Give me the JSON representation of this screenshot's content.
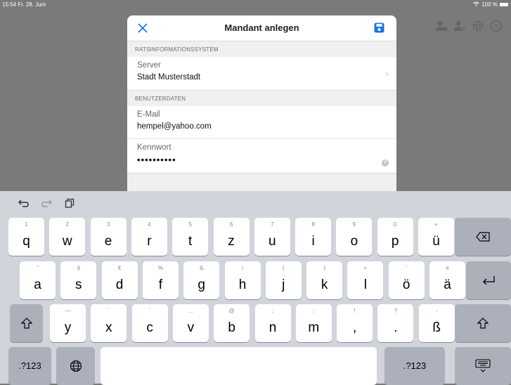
{
  "status": {
    "time": "15:54",
    "date": "Fr. 28. Juni",
    "battery": "100 %"
  },
  "modal": {
    "title": "Mandant anlegen",
    "section1": "RATSINFORMATIONSSYSTEM",
    "server_label": "Server",
    "server_value": "Stadt Musterstadt",
    "section2": "BENUTZERDATEN",
    "email_label": "E-Mail",
    "email_value": "hempel@yahoo.com",
    "password_label": "Kennwort",
    "password_value": "••••••••••"
  },
  "keyboard": {
    "row1": [
      {
        "hint": "1",
        "key": "q"
      },
      {
        "hint": "2",
        "key": "w"
      },
      {
        "hint": "3",
        "key": "e"
      },
      {
        "hint": "4",
        "key": "r"
      },
      {
        "hint": "5",
        "key": "t"
      },
      {
        "hint": "6",
        "key": "z"
      },
      {
        "hint": "7",
        "key": "u"
      },
      {
        "hint": "8",
        "key": "i"
      },
      {
        "hint": "9",
        "key": "o"
      },
      {
        "hint": "0",
        "key": "p"
      },
      {
        "hint": "+",
        "key": "ü"
      }
    ],
    "row2": [
      {
        "hint": "\"",
        "key": "a"
      },
      {
        "hint": "§",
        "key": "s"
      },
      {
        "hint": "€",
        "key": "d"
      },
      {
        "hint": "%",
        "key": "f"
      },
      {
        "hint": "&",
        "key": "g"
      },
      {
        "hint": "/",
        "key": "h"
      },
      {
        "hint": "(",
        "key": "j"
      },
      {
        "hint": ")",
        "key": "k"
      },
      {
        "hint": "=",
        "key": "l"
      },
      {
        "hint": "'",
        "key": "ö"
      },
      {
        "hint": "#",
        "key": "ä"
      }
    ],
    "row3": [
      {
        "hint": "—",
        "key": "y"
      },
      {
        "hint": "`",
        "key": "x"
      },
      {
        "hint": "´",
        "key": "c"
      },
      {
        "hint": "…",
        "key": "v"
      },
      {
        "hint": "@",
        "key": "b"
      },
      {
        "hint": ";",
        "key": "n"
      },
      {
        "hint": ":",
        "key": "m"
      },
      {
        "hint": "!",
        "key": ","
      },
      {
        "hint": "?",
        "key": "."
      },
      {
        "hint": "-",
        "key": "ß"
      }
    ],
    "numbers_left": ".?123",
    "numbers_right": ".?123"
  }
}
